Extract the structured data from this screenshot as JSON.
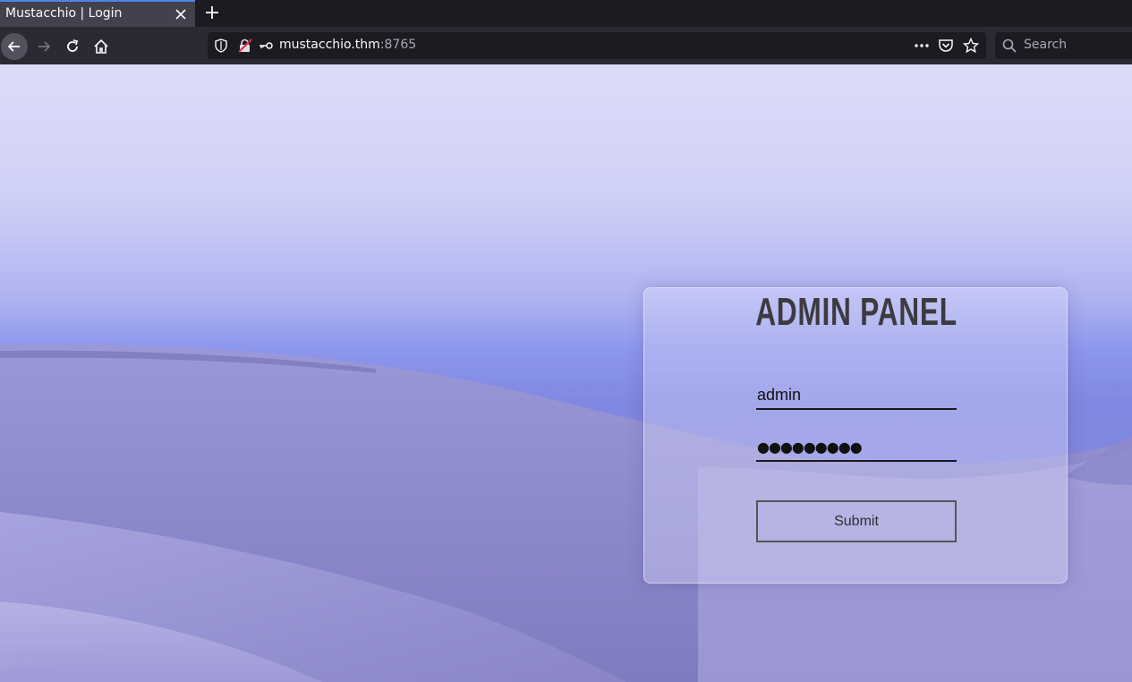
{
  "browser": {
    "tab": {
      "title": "Mustacchio | Login"
    },
    "url": {
      "host": "mustacchio.thm",
      "port": ":8765"
    },
    "search": {
      "placeholder": "Search"
    }
  },
  "page": {
    "login": {
      "title": "ADMIN PANEL",
      "username_value": "admin",
      "password_mask": "●●●●●●●●●",
      "submit_label": "Submit"
    }
  },
  "colors": {
    "tab_active_accent": "#4f84e6",
    "toolbar_bg": "#2b2a33",
    "sky_top": "#dcdcf8",
    "dune": "#8a88cf"
  }
}
